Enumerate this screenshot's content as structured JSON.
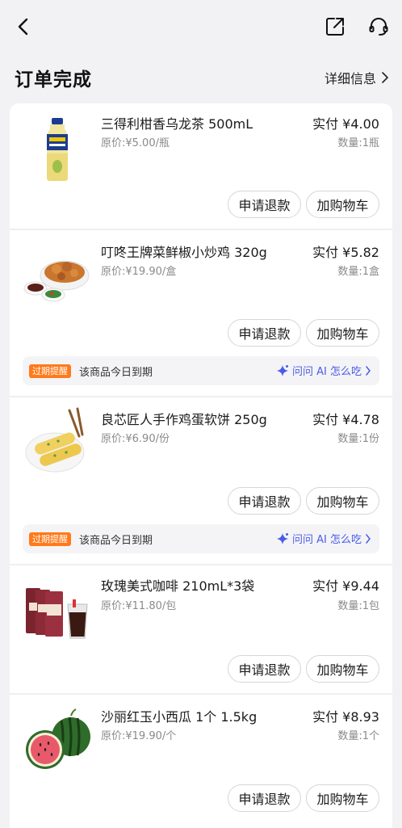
{
  "header": {
    "title": "订单完成",
    "detail_link": "详细信息"
  },
  "products": [
    {
      "name": "三得利柑香乌龙茶 500mL",
      "original_price": "原价:¥5.00/瓶",
      "paid": "实付 ¥4.00",
      "quantity": "数量:1瓶",
      "image_icon": "tea-bottle-image"
    },
    {
      "name": "叮咚王牌菜鲜椒小炒鸡 320g",
      "original_price": "原价:¥19.90/盒",
      "paid": "实付 ¥5.82",
      "quantity": "数量:1盒",
      "image_icon": "stir-fried-chicken-image"
    },
    {
      "name": "良芯匠人手作鸡蛋软饼 250g",
      "original_price": "原价:¥6.90/份",
      "paid": "实付 ¥4.78",
      "quantity": "数量:1份",
      "image_icon": "egg-pancake-image"
    },
    {
      "name": "玫瑰美式咖啡 210mL*3袋",
      "original_price": "原价:¥11.80/包",
      "paid": "实付 ¥9.44",
      "quantity": "数量:1包",
      "image_icon": "coffee-bags-image"
    },
    {
      "name": "沙丽红玉小西瓜 1个 1.5kg",
      "original_price": "原价:¥19.90/个",
      "paid": "实付 ¥8.93",
      "quantity": "数量:1个",
      "image_icon": "watermelon-image"
    }
  ],
  "actions": {
    "refund": "申请退款",
    "add_cart": "加购物车"
  },
  "expiry": {
    "tag": "过期提醒",
    "text": "该商品今日到期",
    "ai_link": "问问 AI 怎么吃"
  },
  "colors": {
    "background": "#f2f2f4",
    "expiry_tag": "#ff7a1a",
    "ai_link": "#4a5be8"
  }
}
